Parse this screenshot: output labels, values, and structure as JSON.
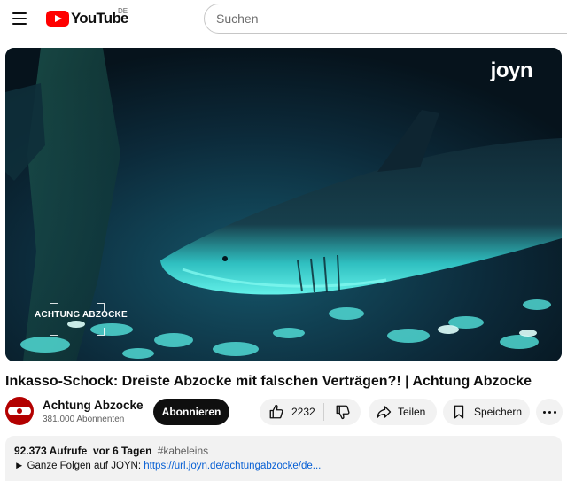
{
  "header": {
    "logo_text": "YouTube",
    "country_code": "DE",
    "search_placeholder": "Suchen"
  },
  "video": {
    "watermark": "joyn",
    "show_badge": "ACHTUNG ABZOCKE",
    "colors": {
      "water": "#0a1d2a",
      "shark_glow": "#39d6d3"
    }
  },
  "title": "Inkasso-Schock: Dreiste Abzocke mit falschen Verträgen?! | Achtung Abzocke",
  "channel": {
    "name": "Achtung Abzocke",
    "subscribers": "381.000 Abonnenten",
    "subscribe_label": "Abonnieren"
  },
  "actions": {
    "like_count": "2232",
    "share_label": "Teilen",
    "save_label": "Speichern"
  },
  "description": {
    "views": "92.373 Aufrufe",
    "age": "vor 6 Tagen",
    "hashtag": "#kabeleins",
    "line_prefix": "► Ganze Folgen auf JOYN: ",
    "link": "https://url.joyn.de/achtungabzocke/de..."
  }
}
